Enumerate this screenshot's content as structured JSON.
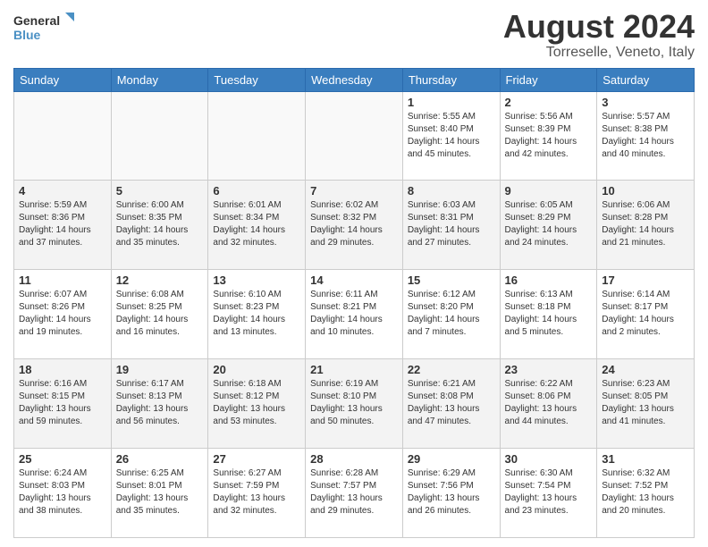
{
  "logo": {
    "line1": "General",
    "line2": "Blue"
  },
  "title": "August 2024",
  "subtitle": "Torreselle, Veneto, Italy",
  "days_of_week": [
    "Sunday",
    "Monday",
    "Tuesday",
    "Wednesday",
    "Thursday",
    "Friday",
    "Saturday"
  ],
  "weeks": [
    [
      {
        "day": "",
        "info": ""
      },
      {
        "day": "",
        "info": ""
      },
      {
        "day": "",
        "info": ""
      },
      {
        "day": "",
        "info": ""
      },
      {
        "day": "1",
        "info": "Sunrise: 5:55 AM\nSunset: 8:40 PM\nDaylight: 14 hours\nand 45 minutes."
      },
      {
        "day": "2",
        "info": "Sunrise: 5:56 AM\nSunset: 8:39 PM\nDaylight: 14 hours\nand 42 minutes."
      },
      {
        "day": "3",
        "info": "Sunrise: 5:57 AM\nSunset: 8:38 PM\nDaylight: 14 hours\nand 40 minutes."
      }
    ],
    [
      {
        "day": "4",
        "info": "Sunrise: 5:59 AM\nSunset: 8:36 PM\nDaylight: 14 hours\nand 37 minutes."
      },
      {
        "day": "5",
        "info": "Sunrise: 6:00 AM\nSunset: 8:35 PM\nDaylight: 14 hours\nand 35 minutes."
      },
      {
        "day": "6",
        "info": "Sunrise: 6:01 AM\nSunset: 8:34 PM\nDaylight: 14 hours\nand 32 minutes."
      },
      {
        "day": "7",
        "info": "Sunrise: 6:02 AM\nSunset: 8:32 PM\nDaylight: 14 hours\nand 29 minutes."
      },
      {
        "day": "8",
        "info": "Sunrise: 6:03 AM\nSunset: 8:31 PM\nDaylight: 14 hours\nand 27 minutes."
      },
      {
        "day": "9",
        "info": "Sunrise: 6:05 AM\nSunset: 8:29 PM\nDaylight: 14 hours\nand 24 minutes."
      },
      {
        "day": "10",
        "info": "Sunrise: 6:06 AM\nSunset: 8:28 PM\nDaylight: 14 hours\nand 21 minutes."
      }
    ],
    [
      {
        "day": "11",
        "info": "Sunrise: 6:07 AM\nSunset: 8:26 PM\nDaylight: 14 hours\nand 19 minutes."
      },
      {
        "day": "12",
        "info": "Sunrise: 6:08 AM\nSunset: 8:25 PM\nDaylight: 14 hours\nand 16 minutes."
      },
      {
        "day": "13",
        "info": "Sunrise: 6:10 AM\nSunset: 8:23 PM\nDaylight: 14 hours\nand 13 minutes."
      },
      {
        "day": "14",
        "info": "Sunrise: 6:11 AM\nSunset: 8:21 PM\nDaylight: 14 hours\nand 10 minutes."
      },
      {
        "day": "15",
        "info": "Sunrise: 6:12 AM\nSunset: 8:20 PM\nDaylight: 14 hours\nand 7 minutes."
      },
      {
        "day": "16",
        "info": "Sunrise: 6:13 AM\nSunset: 8:18 PM\nDaylight: 14 hours\nand 5 minutes."
      },
      {
        "day": "17",
        "info": "Sunrise: 6:14 AM\nSunset: 8:17 PM\nDaylight: 14 hours\nand 2 minutes."
      }
    ],
    [
      {
        "day": "18",
        "info": "Sunrise: 6:16 AM\nSunset: 8:15 PM\nDaylight: 13 hours\nand 59 minutes."
      },
      {
        "day": "19",
        "info": "Sunrise: 6:17 AM\nSunset: 8:13 PM\nDaylight: 13 hours\nand 56 minutes."
      },
      {
        "day": "20",
        "info": "Sunrise: 6:18 AM\nSunset: 8:12 PM\nDaylight: 13 hours\nand 53 minutes."
      },
      {
        "day": "21",
        "info": "Sunrise: 6:19 AM\nSunset: 8:10 PM\nDaylight: 13 hours\nand 50 minutes."
      },
      {
        "day": "22",
        "info": "Sunrise: 6:21 AM\nSunset: 8:08 PM\nDaylight: 13 hours\nand 47 minutes."
      },
      {
        "day": "23",
        "info": "Sunrise: 6:22 AM\nSunset: 8:06 PM\nDaylight: 13 hours\nand 44 minutes."
      },
      {
        "day": "24",
        "info": "Sunrise: 6:23 AM\nSunset: 8:05 PM\nDaylight: 13 hours\nand 41 minutes."
      }
    ],
    [
      {
        "day": "25",
        "info": "Sunrise: 6:24 AM\nSunset: 8:03 PM\nDaylight: 13 hours\nand 38 minutes."
      },
      {
        "day": "26",
        "info": "Sunrise: 6:25 AM\nSunset: 8:01 PM\nDaylight: 13 hours\nand 35 minutes."
      },
      {
        "day": "27",
        "info": "Sunrise: 6:27 AM\nSunset: 7:59 PM\nDaylight: 13 hours\nand 32 minutes."
      },
      {
        "day": "28",
        "info": "Sunrise: 6:28 AM\nSunset: 7:57 PM\nDaylight: 13 hours\nand 29 minutes."
      },
      {
        "day": "29",
        "info": "Sunrise: 6:29 AM\nSunset: 7:56 PM\nDaylight: 13 hours\nand 26 minutes."
      },
      {
        "day": "30",
        "info": "Sunrise: 6:30 AM\nSunset: 7:54 PM\nDaylight: 13 hours\nand 23 minutes."
      },
      {
        "day": "31",
        "info": "Sunrise: 6:32 AM\nSunset: 7:52 PM\nDaylight: 13 hours\nand 20 minutes."
      }
    ]
  ]
}
